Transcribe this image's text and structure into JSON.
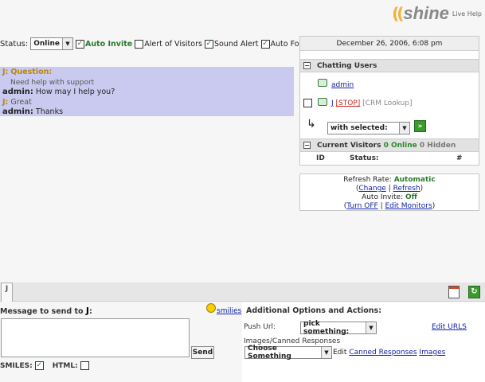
{
  "logo": {
    "word": "shine",
    "subtitle": "Live Help"
  },
  "status": {
    "label": "Status:",
    "value": "Online",
    "checks": [
      {
        "label": "Auto Invite",
        "checked": true,
        "highlight": true
      },
      {
        "label": "Alert of Visitors",
        "checked": false,
        "highlight": false
      },
      {
        "label": "Sound Alert",
        "checked": true,
        "highlight": false
      },
      {
        "label": "Auto Focus",
        "checked": true,
        "highlight": false
      }
    ]
  },
  "chat": {
    "lines": [
      {
        "name": "J:",
        "text": "Question:",
        "kind": "visitor"
      },
      {
        "name": "",
        "text": "Need help with support",
        "kind": "visitor-body"
      },
      {
        "name": "admin:",
        "text": "How may I help you?",
        "kind": "admin"
      },
      {
        "name": "J:",
        "text": "Great",
        "kind": "visitor"
      },
      {
        "name": "admin:",
        "text": "Thanks",
        "kind": "admin"
      }
    ]
  },
  "panel": {
    "date": "December 26, 2006, 6:08 pm",
    "chatting_users": {
      "title": "Chatting Users",
      "user1": "admin",
      "user2_name": "J",
      "user2_stop": "[STOP]",
      "user2_crm": "[CRM Lookup]",
      "with_selected": "with selected:"
    },
    "visitors": {
      "title_prefix": "Current Visitors",
      "online_count": "0",
      "online_label": "Online",
      "hidden_count": "0",
      "hidden_label": "Hidden",
      "col_id": "ID",
      "col_status": "Status:",
      "col_hash": "#"
    }
  },
  "refresh": {
    "rate_label": "Refresh Rate:",
    "rate_value": "Automatic",
    "open": "(",
    "change": "Change",
    "sep": "|",
    "refresh": "Refresh",
    "close": ")",
    "auto_invite_label": "Auto Invite:",
    "auto_invite_value": "Off",
    "turn_off": "Turn OFF",
    "edit_monitors": "Edit Monitors"
  },
  "tabs": {
    "active": "J"
  },
  "message": {
    "label": "Message to send to",
    "recipient": "J",
    "colon": ":",
    "smilies": "smilies",
    "send": "Send",
    "smiles_label": "SMILES:",
    "smiles_checked": true,
    "html_label": "HTML:",
    "html_checked": false
  },
  "options": {
    "title": "Additional Options and Actions:",
    "push_label": "Push Url:",
    "push_value": "pick something:",
    "edit_urls": "Edit URLS",
    "images_label": "Images/Canned Responses",
    "canned_value": "Choose Something",
    "edit_label": "Edit",
    "canned_link": "Canned Responses",
    "images_link": "Images"
  }
}
